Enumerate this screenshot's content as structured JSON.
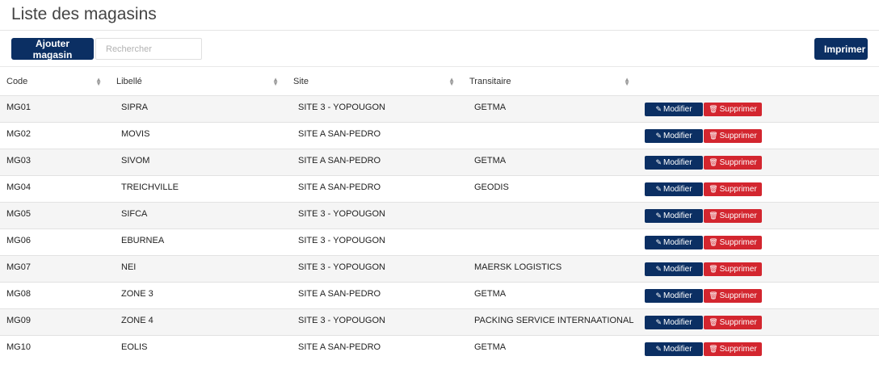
{
  "page": {
    "title": "Liste des magasins"
  },
  "toolbar": {
    "add_label": "Ajouter magasin",
    "search_placeholder": "Rechercher",
    "print_label": "Imprimer"
  },
  "table": {
    "columns": [
      "Code",
      "Libellé",
      "Site",
      "Transitaire"
    ],
    "edit_label": "Modifier",
    "delete_label": "Supprimer",
    "rows": [
      {
        "code": "MG01",
        "libelle": "SIPRA",
        "site": "SITE 3 - YOPOUGON",
        "transitaire": "GETMA"
      },
      {
        "code": "MG02",
        "libelle": "MOVIS",
        "site": "SITE A SAN-PEDRO",
        "transitaire": ""
      },
      {
        "code": "MG03",
        "libelle": "SIVOM",
        "site": "SITE A SAN-PEDRO",
        "transitaire": "GETMA"
      },
      {
        "code": "MG04",
        "libelle": "TREICHVILLE",
        "site": "SITE A SAN-PEDRO",
        "transitaire": "GEODIS"
      },
      {
        "code": "MG05",
        "libelle": "SIFCA",
        "site": "SITE 3 - YOPOUGON",
        "transitaire": ""
      },
      {
        "code": "MG06",
        "libelle": "EBURNEA",
        "site": "SITE 3 - YOPOUGON",
        "transitaire": ""
      },
      {
        "code": "MG07",
        "libelle": "NEI",
        "site": "SITE 3 - YOPOUGON",
        "transitaire": "MAERSK LOGISTICS"
      },
      {
        "code": "MG08",
        "libelle": "ZONE 3",
        "site": "SITE A SAN-PEDRO",
        "transitaire": "GETMA"
      },
      {
        "code": "MG09",
        "libelle": "ZONE 4",
        "site": "SITE 3 - YOPOUGON",
        "transitaire": "PACKING SERVICE INTERNAATIONAL"
      },
      {
        "code": "MG10",
        "libelle": "EOLIS",
        "site": "SITE A SAN-PEDRO",
        "transitaire": "GETMA"
      }
    ]
  },
  "colors": {
    "primary": "#0b2f63",
    "danger": "#d3262f",
    "row_stripe": "#f5f5f5"
  },
  "icons": {
    "edit": "edit-icon",
    "delete": "trash-icon",
    "sort": "sort-icon"
  }
}
